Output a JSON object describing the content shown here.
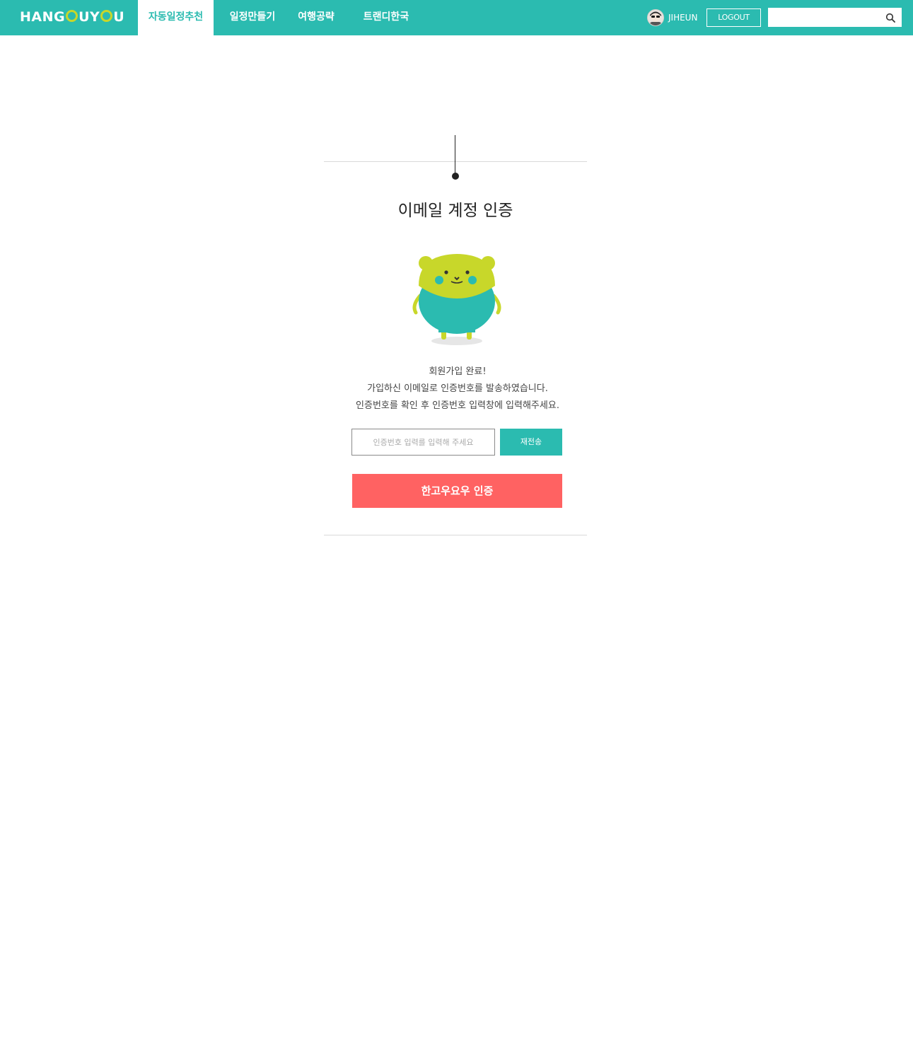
{
  "brand": {
    "logo_text": "HANGOUYOU",
    "primary_color": "#2bbbb0",
    "accent_color": "#c8d72a",
    "cta_color": "#ff6262"
  },
  "nav": {
    "items": [
      {
        "label": "자동일정추천",
        "active": true
      },
      {
        "label": "일정만들기",
        "active": false
      },
      {
        "label": "여행공략",
        "active": false
      },
      {
        "label": "트랜디한국",
        "active": false
      }
    ]
  },
  "user": {
    "name": "JIHEUN",
    "logout_label": "LOGOUT"
  },
  "search": {
    "value": "",
    "placeholder": "",
    "icon": "search-icon"
  },
  "main": {
    "title": "이메일 계정 인증",
    "message_lines": [
      "회원가입 완료!",
      "가입하신 이메일로 인증번호를 발송하였습니다.",
      "인증번호를 확인 후 인증번호 입력창에 입력해주세요."
    ],
    "code_input": {
      "value": "",
      "placeholder": "인증번호 입력를 입력해 주세요"
    },
    "resend_label": "재전송",
    "verify_label": "한고우요우 인증"
  }
}
